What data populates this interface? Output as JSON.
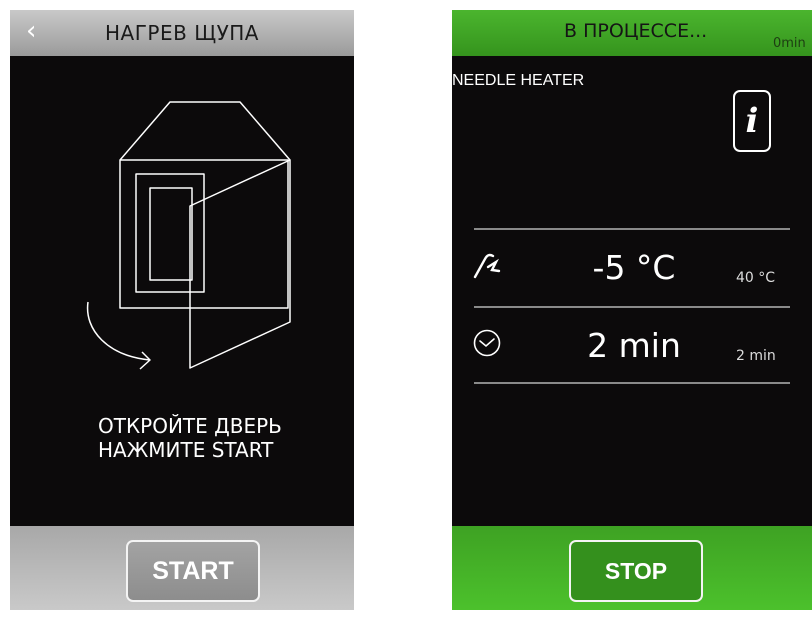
{
  "left_screen": {
    "header": {
      "title": "НАГРЕВ ЩУПА",
      "back_icon": "chevron-left-icon",
      "back_glyph": "‹"
    },
    "illustration": "oven-door-open-icon",
    "instructions": [
      "ОТКРОЙТЕ ДВЕРЬ",
      "НАЖМИТЕ START"
    ],
    "footer": {
      "start_label": "START"
    },
    "colors": {
      "header": "#b5b5b5",
      "background": "#0c0a0b",
      "footer": "#b8b8b8"
    }
  },
  "right_screen": {
    "header": {
      "title": "В ПРОЦЕССЕ...",
      "elapsed": "0min"
    },
    "program_name": "NEEDLE HEATER",
    "info": {
      "icon": "info-icon",
      "glyph": "i"
    },
    "rows": [
      {
        "icon": "probe-icon",
        "value": "-5 °C",
        "target": "40 °C"
      },
      {
        "icon": "clock-icon",
        "value": "2 min",
        "target": "2 min"
      }
    ],
    "footer": {
      "stop_label": "STOP"
    },
    "colors": {
      "header": "#3fa626",
      "background": "#0c0a0b",
      "footer": "#44b428"
    }
  }
}
